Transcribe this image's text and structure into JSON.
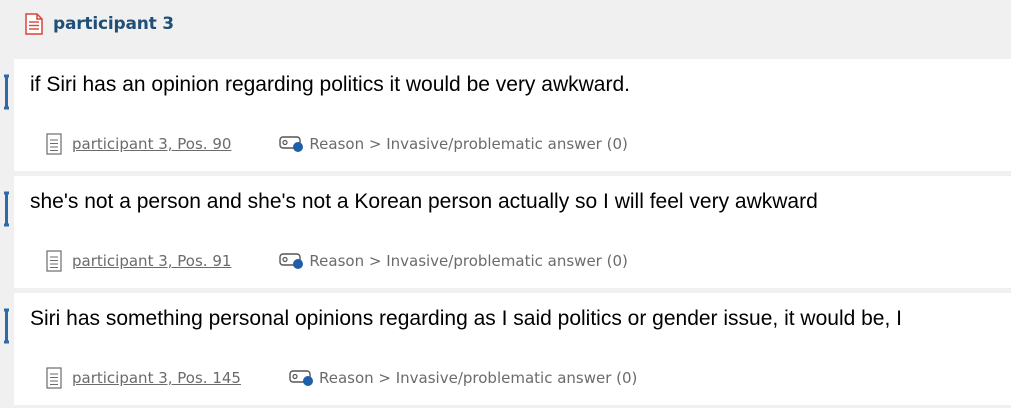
{
  "document": {
    "title": "participant 3",
    "icon": "document-icon",
    "icon_color": "#d9453a",
    "title_color": "#1f4e79"
  },
  "segments": [
    {
      "text": "if Siri has an opinion regarding politics it would be very awkward.",
      "source": "participant 3, Pos. 90",
      "code": "Reason > Invasive/problematic answer (0)"
    },
    {
      "text": "she's not a person and she's not a Korean person actually so I will feel very awkward",
      "source": "participant 3, Pos. 91",
      "code": "Reason > Invasive/problematic answer (0)"
    },
    {
      "text": "Siri has something personal opinions regarding as I said politics or gender issue, it would be, I",
      "source": "participant 3, Pos. 145",
      "code": "Reason > Invasive/problematic answer (0)"
    }
  ],
  "colors": {
    "bracket": "#2e6aa8",
    "code_dot": "#1e5fa8",
    "meta_text": "#6b6b6b"
  }
}
